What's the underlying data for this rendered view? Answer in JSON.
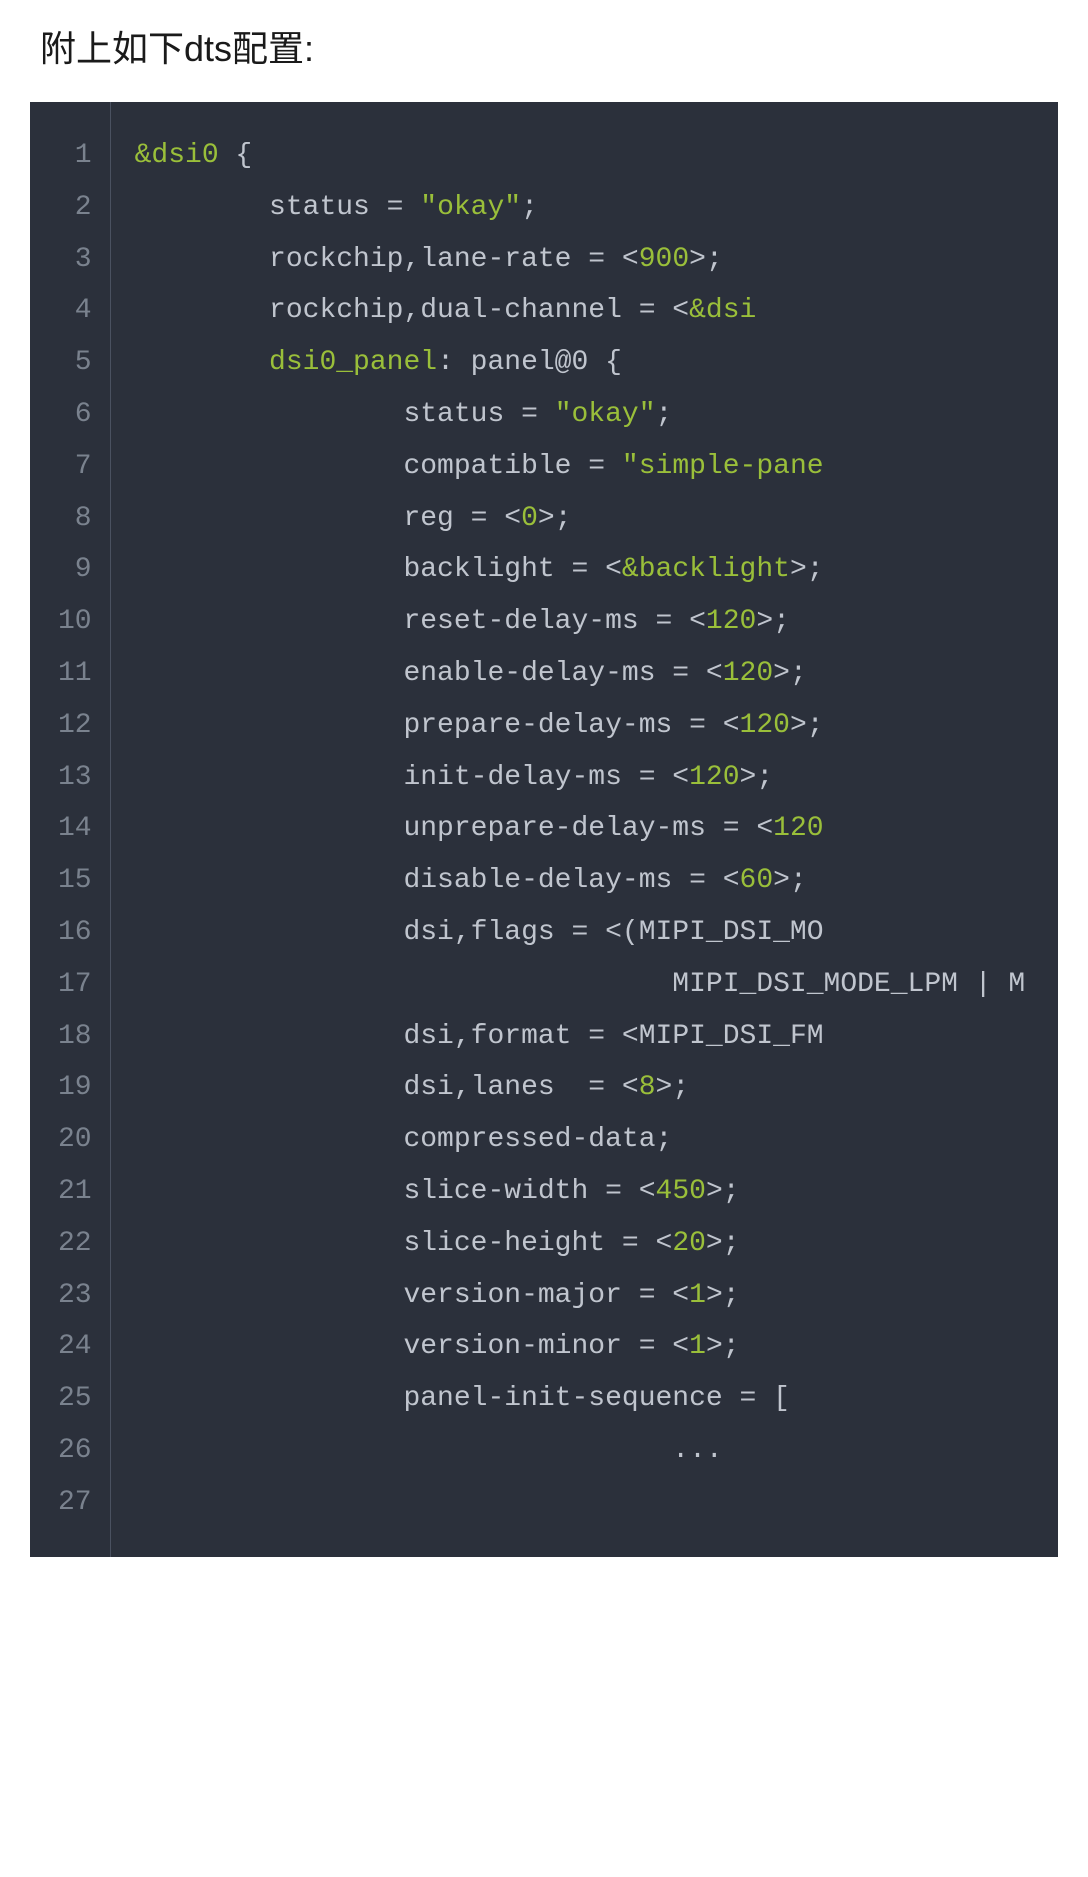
{
  "heading": "附上如下dts配置:",
  "code": {
    "line_count": 27,
    "lines": [
      {
        "n": 1,
        "tokens": [
          {
            "t": "&dsi0",
            "c": "tok-ref"
          },
          {
            "t": " {",
            "c": "tok-punc"
          }
        ]
      },
      {
        "n": 2,
        "indent": 2,
        "tokens": [
          {
            "t": "status ",
            "c": "tok-prop"
          },
          {
            "t": "=",
            "c": "tok-punc"
          },
          {
            "t": " \"okay\"",
            "c": "tok-str"
          },
          {
            "t": ";",
            "c": "tok-punc"
          }
        ]
      },
      {
        "n": 3,
        "indent": 2,
        "tokens": [
          {
            "t": "rockchip,lane-rate ",
            "c": "tok-prop"
          },
          {
            "t": "= <",
            "c": "tok-punc"
          },
          {
            "t": "900",
            "c": "tok-num"
          },
          {
            "t": ">;",
            "c": "tok-punc"
          }
        ]
      },
      {
        "n": 4,
        "indent": 2,
        "tokens": [
          {
            "t": "rockchip,dual-channel ",
            "c": "tok-prop"
          },
          {
            "t": "= <",
            "c": "tok-punc"
          },
          {
            "t": "&dsi",
            "c": "tok-ref"
          }
        ]
      },
      {
        "n": 5,
        "indent": 2,
        "tokens": [
          {
            "t": "dsi0_panel",
            "c": "tok-label"
          },
          {
            "t": ": ",
            "c": "tok-punc"
          },
          {
            "t": "panel@0",
            "c": "tok-node"
          },
          {
            "t": " {",
            "c": "tok-punc"
          }
        ]
      },
      {
        "n": 6,
        "indent": 4,
        "tokens": [
          {
            "t": "status ",
            "c": "tok-prop"
          },
          {
            "t": "=",
            "c": "tok-punc"
          },
          {
            "t": " \"okay\"",
            "c": "tok-str"
          },
          {
            "t": ";",
            "c": "tok-punc"
          }
        ]
      },
      {
        "n": 7,
        "indent": 4,
        "tokens": [
          {
            "t": "compatible ",
            "c": "tok-prop"
          },
          {
            "t": "=",
            "c": "tok-punc"
          },
          {
            "t": " \"simple-pane",
            "c": "tok-str"
          }
        ]
      },
      {
        "n": 8,
        "indent": 4,
        "tokens": [
          {
            "t": "reg ",
            "c": "tok-prop"
          },
          {
            "t": "= <",
            "c": "tok-punc"
          },
          {
            "t": "0",
            "c": "tok-num"
          },
          {
            "t": ">;",
            "c": "tok-punc"
          }
        ]
      },
      {
        "n": 9,
        "indent": 4,
        "tokens": [
          {
            "t": "backlight ",
            "c": "tok-prop"
          },
          {
            "t": "= <",
            "c": "tok-punc"
          },
          {
            "t": "&backlight",
            "c": "tok-ref"
          },
          {
            "t": ">;",
            "c": "tok-punc"
          }
        ]
      },
      {
        "n": 10,
        "indent": 4,
        "tokens": [
          {
            "t": "reset-delay-ms ",
            "c": "tok-prop"
          },
          {
            "t": "= <",
            "c": "tok-punc"
          },
          {
            "t": "120",
            "c": "tok-num"
          },
          {
            "t": ">;",
            "c": "tok-punc"
          }
        ]
      },
      {
        "n": 11,
        "indent": 4,
        "tokens": [
          {
            "t": "enable-delay-ms ",
            "c": "tok-prop"
          },
          {
            "t": "= <",
            "c": "tok-punc"
          },
          {
            "t": "120",
            "c": "tok-num"
          },
          {
            "t": ">;",
            "c": "tok-punc"
          }
        ]
      },
      {
        "n": 12,
        "indent": 4,
        "tokens": [
          {
            "t": "prepare-delay-ms ",
            "c": "tok-prop"
          },
          {
            "t": "= <",
            "c": "tok-punc"
          },
          {
            "t": "120",
            "c": "tok-num"
          },
          {
            "t": ">;",
            "c": "tok-punc"
          }
        ]
      },
      {
        "n": 13,
        "indent": 4,
        "tokens": [
          {
            "t": "init-delay-ms ",
            "c": "tok-prop"
          },
          {
            "t": "= <",
            "c": "tok-punc"
          },
          {
            "t": "120",
            "c": "tok-num"
          },
          {
            "t": ">;",
            "c": "tok-punc"
          }
        ]
      },
      {
        "n": 14,
        "indent": 4,
        "tokens": [
          {
            "t": "unprepare-delay-ms ",
            "c": "tok-prop"
          },
          {
            "t": "= <",
            "c": "tok-punc"
          },
          {
            "t": "120",
            "c": "tok-num"
          }
        ]
      },
      {
        "n": 15,
        "indent": 4,
        "tokens": [
          {
            "t": "disable-delay-ms ",
            "c": "tok-prop"
          },
          {
            "t": "= <",
            "c": "tok-punc"
          },
          {
            "t": "60",
            "c": "tok-num"
          },
          {
            "t": ">;",
            "c": "tok-punc"
          }
        ]
      },
      {
        "n": 16,
        "indent": 4,
        "tokens": [
          {
            "t": "dsi,flags ",
            "c": "tok-prop"
          },
          {
            "t": "= <(",
            "c": "tok-punc"
          },
          {
            "t": "MIPI_DSI_MO",
            "c": "tok-const"
          }
        ]
      },
      {
        "n": 17,
        "indent": 8,
        "tokens": [
          {
            "t": "MIPI_DSI_MODE_LPM",
            "c": "tok-const"
          },
          {
            "t": " | ",
            "c": "tok-punc"
          },
          {
            "t": "M",
            "c": "tok-const"
          }
        ]
      },
      {
        "n": 18,
        "indent": 4,
        "tokens": [
          {
            "t": "dsi,format ",
            "c": "tok-prop"
          },
          {
            "t": "= <",
            "c": "tok-punc"
          },
          {
            "t": "MIPI_DSI_FM",
            "c": "tok-const"
          }
        ]
      },
      {
        "n": 19,
        "indent": 4,
        "tokens": [
          {
            "t": "dsi,lanes  ",
            "c": "tok-prop"
          },
          {
            "t": "= <",
            "c": "tok-punc"
          },
          {
            "t": "8",
            "c": "tok-num"
          },
          {
            "t": ">;",
            "c": "tok-punc"
          }
        ]
      },
      {
        "n": 20,
        "indent": 4,
        "tokens": [
          {
            "t": "compressed-data",
            "c": "tok-prop"
          },
          {
            "t": ";",
            "c": "tok-punc"
          }
        ]
      },
      {
        "n": 21,
        "indent": 4,
        "tokens": [
          {
            "t": "slice-width ",
            "c": "tok-prop"
          },
          {
            "t": "= <",
            "c": "tok-punc"
          },
          {
            "t": "450",
            "c": "tok-num"
          },
          {
            "t": ">;",
            "c": "tok-punc"
          }
        ]
      },
      {
        "n": 22,
        "indent": 4,
        "tokens": [
          {
            "t": "slice-height ",
            "c": "tok-prop"
          },
          {
            "t": "= <",
            "c": "tok-punc"
          },
          {
            "t": "20",
            "c": "tok-num"
          },
          {
            "t": ">;",
            "c": "tok-punc"
          }
        ]
      },
      {
        "n": 23,
        "indent": 4,
        "tokens": [
          {
            "t": "version-major ",
            "c": "tok-prop"
          },
          {
            "t": "= <",
            "c": "tok-punc"
          },
          {
            "t": "1",
            "c": "tok-num"
          },
          {
            "t": ">;",
            "c": "tok-punc"
          }
        ]
      },
      {
        "n": 24,
        "indent": 4,
        "tokens": [
          {
            "t": "version-minor ",
            "c": "tok-prop"
          },
          {
            "t": "= <",
            "c": "tok-punc"
          },
          {
            "t": "1",
            "c": "tok-num"
          },
          {
            "t": ">;",
            "c": "tok-punc"
          }
        ]
      },
      {
        "n": 25,
        "indent": 0,
        "tokens": [
          {
            "t": "",
            "c": "tok-punc"
          }
        ]
      },
      {
        "n": 26,
        "indent": 4,
        "tokens": [
          {
            "t": "panel-init-sequence ",
            "c": "tok-prop"
          },
          {
            "t": "= [",
            "c": "tok-punc"
          }
        ]
      },
      {
        "n": 27,
        "indent": 8,
        "tokens": [
          {
            "t": "...",
            "c": "tok-punc"
          }
        ]
      }
    ]
  }
}
